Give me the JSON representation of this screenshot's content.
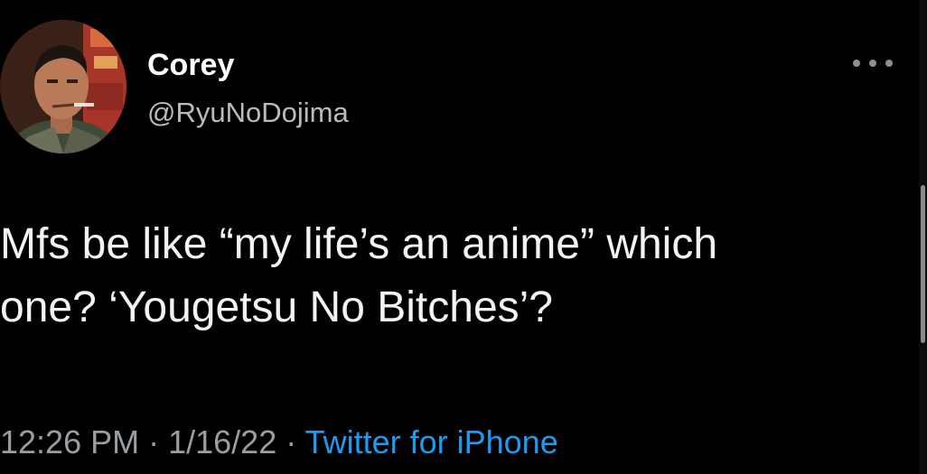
{
  "tweet": {
    "author": {
      "display_name": "Corey",
      "handle": "@RyuNoDojima",
      "avatar_icon": "profile-avatar"
    },
    "more_icon": "ellipsis-horizontal-icon",
    "text": "Mfs be like “my life’s an anime” which\none? ‘Yougetsu No Bitches’?",
    "time": "12:26 PM",
    "date": "1/16/22",
    "separator": "·",
    "source": "Twitter for iPhone"
  },
  "colors": {
    "background": "#000000",
    "name": "#ffffff",
    "handle": "#b7bcc0",
    "body_text": "#f2f3f4",
    "meta": "#999ea3",
    "link": "#1d9bf0"
  }
}
